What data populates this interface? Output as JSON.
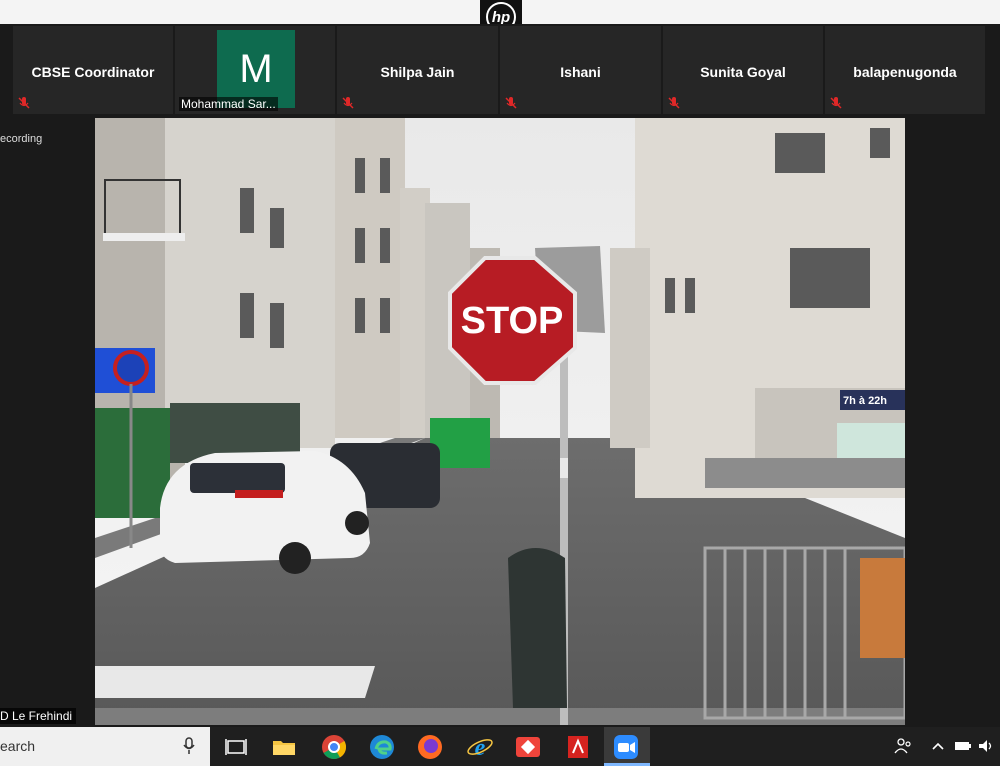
{
  "participants": [
    {
      "name": "CBSE Coordinator",
      "muted": true
    },
    {
      "name": "Mohammad Sar...",
      "avatar_letter": "M",
      "avatar_color": "#0e6b4f"
    },
    {
      "name": "Shilpa Jain",
      "muted": true
    },
    {
      "name": "Ishani",
      "muted": true
    },
    {
      "name": "Sunita Goyal",
      "muted": true
    },
    {
      "name": "balapenugonda",
      "muted": true
    }
  ],
  "recording_text": "ecording",
  "speaker_name": "D Le Frehindi",
  "sign": {
    "stop": "STOP",
    "store_hours": "7h à 22h"
  },
  "taskbar": {
    "search_placeholder": "earch",
    "apps": [
      "task-view",
      "file-explorer",
      "chrome",
      "edge",
      "firefox",
      "internet-explorer",
      "anydesk",
      "acrobat",
      "zoom"
    ]
  },
  "colors": {
    "meeting_bg": "#1a1a1a",
    "tile_bg": "#262626",
    "mute_red": "#e02828",
    "zoom_blue": "#2d8cff"
  }
}
